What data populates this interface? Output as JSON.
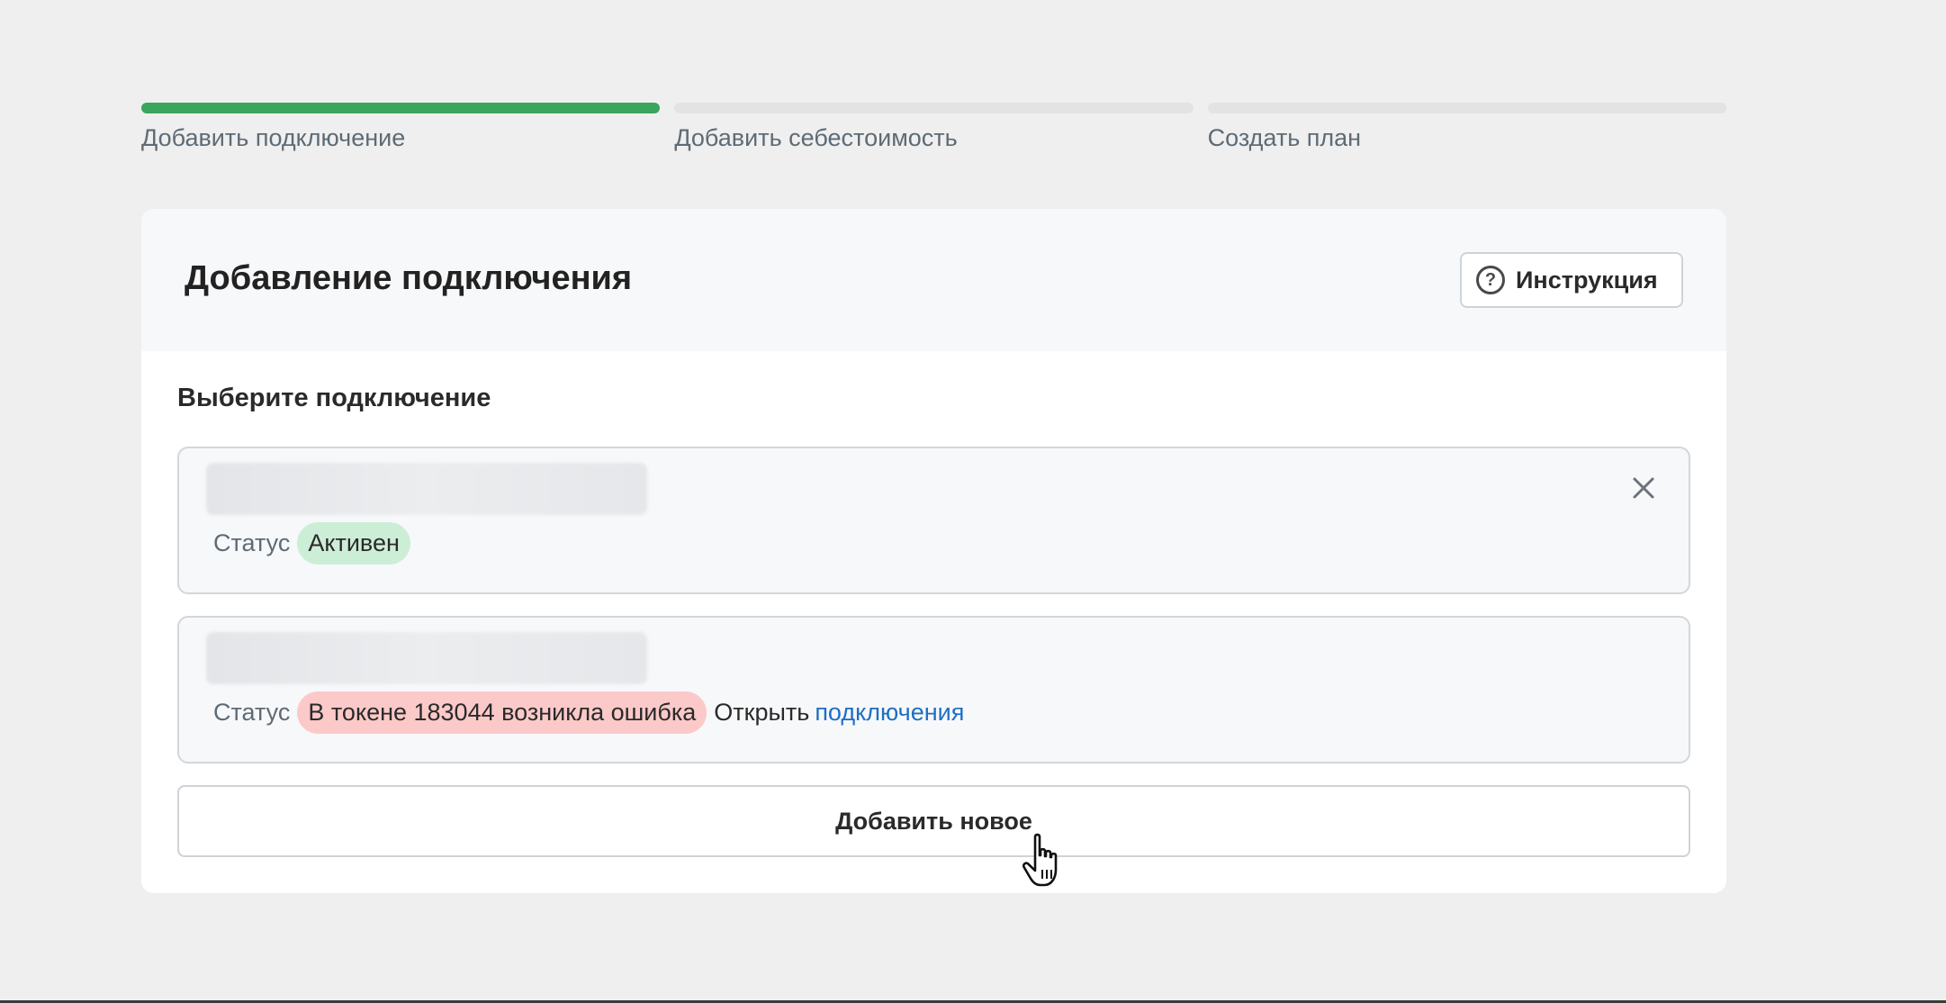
{
  "stepper": {
    "steps": [
      {
        "label": "Добавить подключение",
        "state": "completed"
      },
      {
        "label": "Добавить себестоимость",
        "state": "pending"
      },
      {
        "label": "Создать план",
        "state": "pending"
      }
    ]
  },
  "card": {
    "title": "Добавление подключения",
    "instruction_label": "Инструкция",
    "section_label": "Выберите подключение",
    "connections": [
      {
        "status_key": "Статус",
        "status_value": "Активен",
        "status_color": "#cdeed6"
      },
      {
        "status_key": "Статус",
        "status_value": "В токене 183044 возникла ошибка",
        "status_color": "#fcc9c9",
        "open_text": "Открыть",
        "link_text": "подключения"
      }
    ],
    "add_new_label": "Добавить новое"
  },
  "colors": {
    "accent_green": "#3aa55c",
    "link_blue": "#1e6fc4",
    "page_bg": "#efefef"
  },
  "icons": [
    "help-circle-icon",
    "close-icon",
    "hand-pointer-cursor-icon"
  ]
}
